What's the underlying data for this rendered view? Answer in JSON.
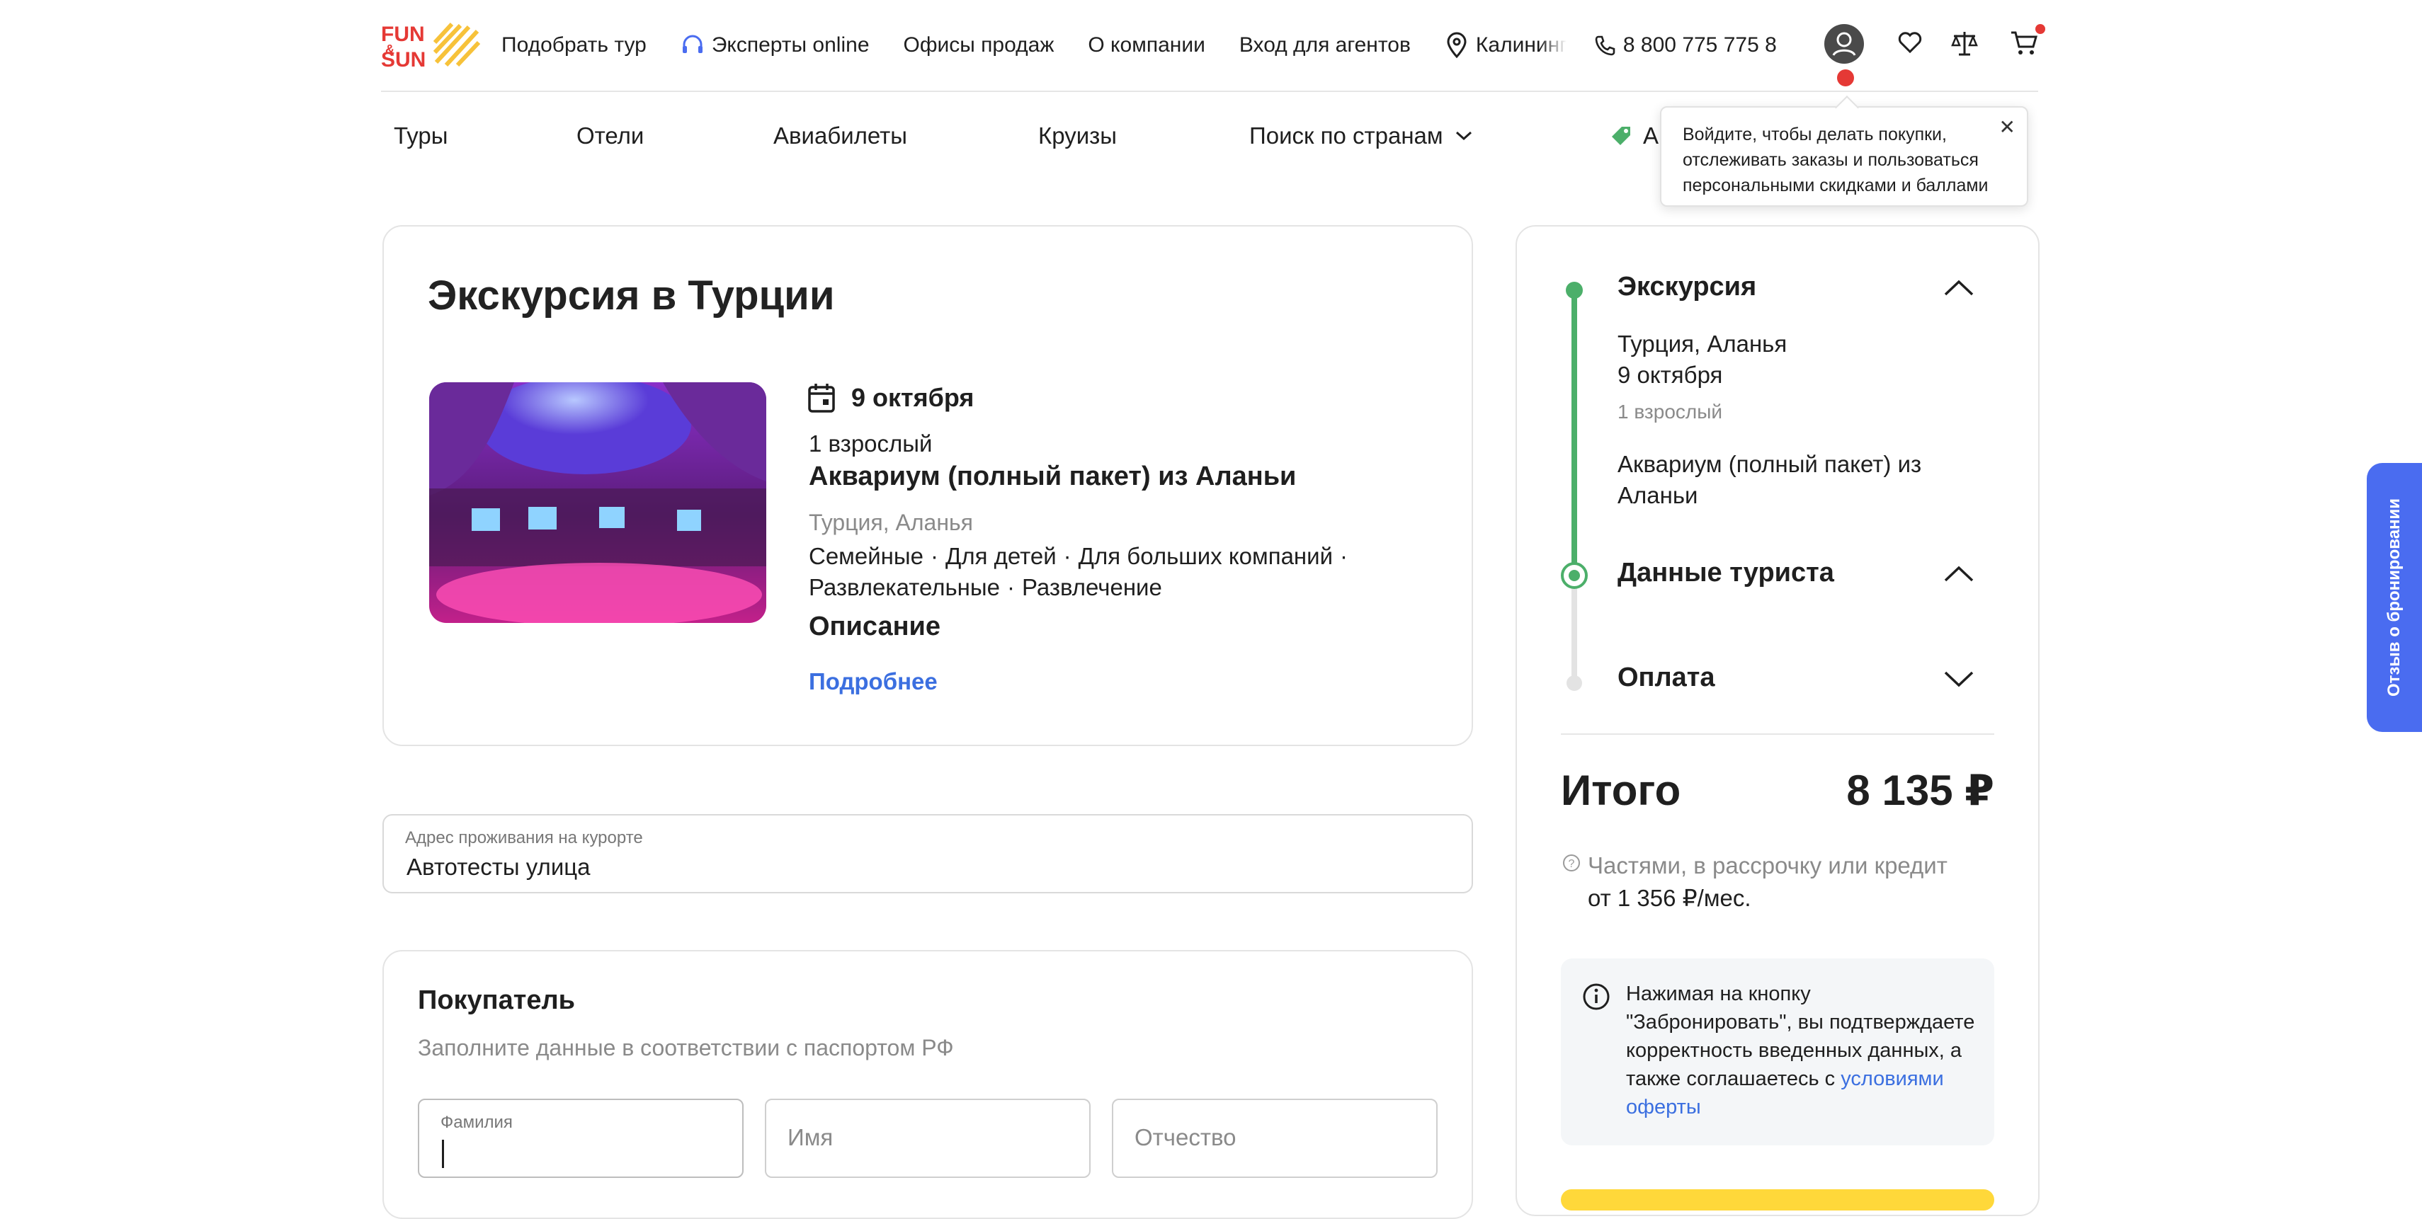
{
  "header": {
    "logo": "FUN & SUN",
    "nav": [
      "Подобрать тур",
      "Эксперты online",
      "Офисы продаж",
      "О компании",
      "Вход для агентов"
    ],
    "city": "Калининг",
    "phone": "8 800 775 775 8"
  },
  "secondary_nav": {
    "items": [
      "Туры",
      "Отели",
      "Авиабилеты",
      "Круизы",
      "Поиск по странам"
    ],
    "promo_partial": "А"
  },
  "tooltip": {
    "text": "Войдите, чтобы делать покупки, отслеживать заказы и пользоваться персональными скидками и баллами",
    "close": "✕"
  },
  "excursion_card": {
    "title": "Экскурсия в Турции",
    "date": "9 октября",
    "adults": "1 взрослый",
    "name": "Аквариум (полный пакет) из Аланьи",
    "location": "Турция, Аланья",
    "tags": [
      "Семейные",
      "Для детей",
      "Для больших компаний",
      "Развлекательные",
      "Развлечение"
    ],
    "description_heading": "Описание",
    "more_link": "Подробнее"
  },
  "address": {
    "label": "Адрес проживания на курорте",
    "value": "Автотесты улица"
  },
  "buyer": {
    "heading": "Покупатель",
    "subtitle": "Заполните данные в соответствии с паспортом РФ",
    "fields": [
      {
        "label": "Фамилия",
        "value": ""
      },
      {
        "placeholder": "Имя"
      },
      {
        "placeholder": "Отчество"
      }
    ]
  },
  "summary": {
    "steps": [
      {
        "title": "Экскурсия",
        "lines": [
          "Турция, Аланья",
          "9 октября"
        ],
        "grey": "1 взрослый",
        "extra": "Аквариум (полный пакет) из Аланьи",
        "state": "expanded"
      },
      {
        "title": "Данные туриста",
        "state": "expanded"
      },
      {
        "title": "Оплата",
        "state": "collapsed"
      }
    ],
    "total_label": "Итого",
    "total_value": "8 135 ₽",
    "installment_text": "Частями, в рассрочку или кредит",
    "installment_value": "от 1 356 ₽/мес.",
    "notice_text": "Нажимая на кнопку \"Забронировать\", вы подтверждаете корректность введенных данных, а также соглашаетесь с",
    "notice_link": "условиями оферты"
  },
  "feedback_tab": "Отзыв о бронировании",
  "colors": {
    "accent_green": "#4caf6a",
    "link_blue": "#3b6fe0",
    "feedback_blue": "#4a6cf0",
    "brand_red": "#e53935",
    "brand_yellow": "#f7c23a"
  }
}
